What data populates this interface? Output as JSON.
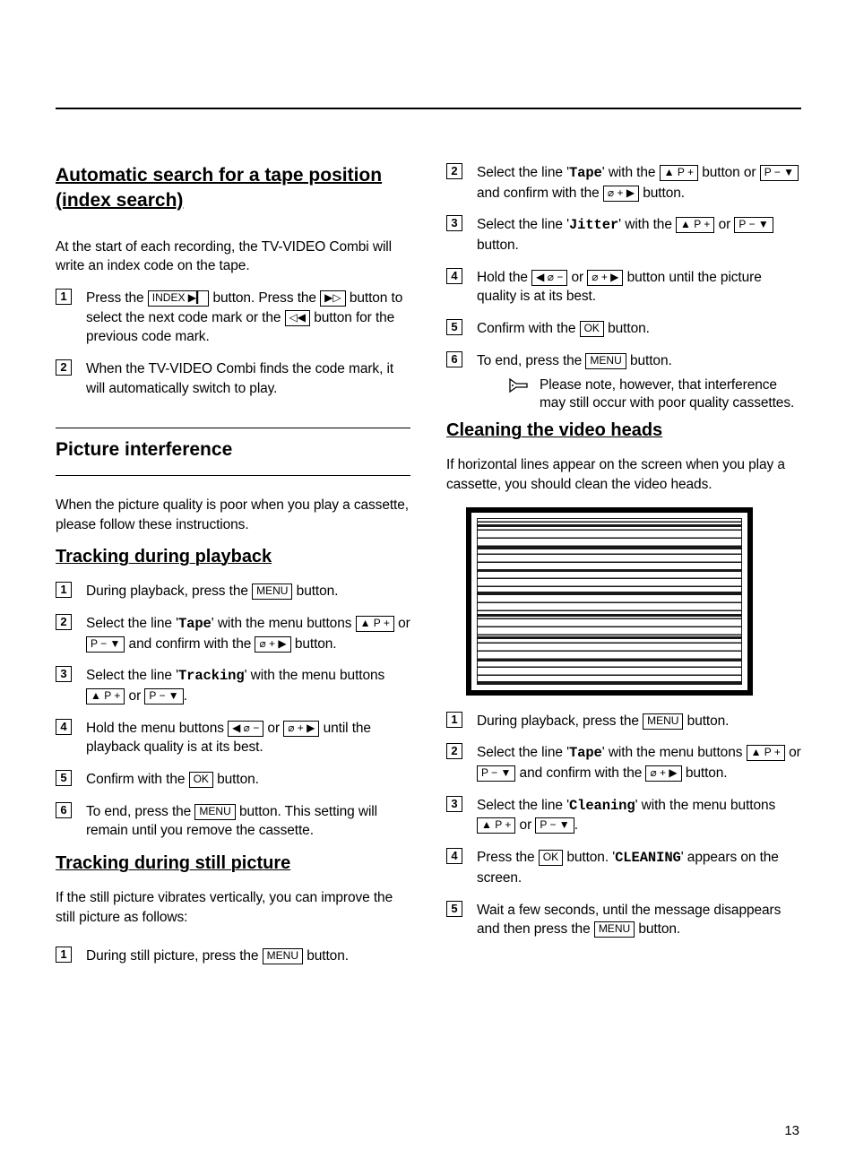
{
  "pagenum": "13",
  "keys": {
    "index": "INDEX ▶▎",
    "ff": "▶▷",
    "rew": "◁◀",
    "menu": "MENU",
    "pplus": "▲ P +",
    "pminus": "P − ▼",
    "aplus": "⌀ + ▶",
    "aminus": "◀ ⌀ −",
    "ok": "OK"
  },
  "left": {
    "s1_title": "Automatic search for a tape position (index search)",
    "s1_intro": "At the start of each recording, the TV-VIDEO Combi will write an index code on the tape.",
    "s1_step1a": "Press the ",
    "s1_step1b": " button. Press the ",
    "s1_step1c": " button to select the next code mark or the ",
    "s1_step1d": " button for the previous code mark.",
    "s1_step2": "When the TV-VIDEO Combi finds the code mark, it will automatically switch to play.",
    "s2_title": "Picture interference",
    "s2_intro": "When the picture quality is poor when you play a cassette, please follow these instructions.",
    "s2a_title": "Tracking during playback",
    "s2a_1a": "During playback, press the ",
    "s2a_1b": " button.",
    "s2a_2a": "Select the line '",
    "s2a_2tape": "Tape",
    "s2a_2b": "' with the menu buttons ",
    "s2a_2c": " or ",
    "s2a_2d": " and confirm with the ",
    "s2a_2e": " button.",
    "s2a_3a": "Select the line '",
    "s2a_3track": "Tracking",
    "s2a_3b": "' with the menu buttons ",
    "s2a_3c": " or ",
    "s2a_3d": ".",
    "s2a_4a": "Hold the menu buttons ",
    "s2a_4b": " or ",
    "s2a_4c": " until the playback quality is at its best.",
    "s2a_5a": "Confirm with the ",
    "s2a_5b": " button.",
    "s2a_6a": "To end, press the ",
    "s2a_6b": " button. This setting will remain until you remove the cassette.",
    "s2b_title": "Tracking during still picture",
    "s2b_intro": "If the still picture vibrates vertically, you can improve the still picture as follows:",
    "s2b_1a": "During still picture, press the ",
    "s2b_1b": " button.",
    "s2b_2a": "Select the line '",
    "s2b_2tape": "Tape",
    "s2b_2b": "' with the ",
    "s2b_2c": " button or ",
    "s2b_2d": " and confirm with the ",
    "s2b_2e": " button.",
    "s2b_3a": "Select the line '",
    "s2b_3jit": "Jitter",
    "s2b_3b": "' with the ",
    "s2b_3c": " or ",
    "s2b_3d": " button."
  },
  "right": {
    "r_4a": "Hold the ",
    "r_4b": " or ",
    "r_4c": " button until the picture quality is at its best.",
    "r_5a": "Confirm with the ",
    "r_5b": " button.",
    "r_6a": "To end, press the ",
    "r_6b": " button.",
    "r_note": "Please note, however, that interference may still occur with poor quality cassettes.",
    "c_title": "Cleaning the video heads",
    "c_intro": "If horizontal lines appear on the screen when you play a cassette, you should clean the video heads.",
    "c_1a": "During playback, press the ",
    "c_1b": " button.",
    "c_2a": "Select the line '",
    "c_2tape": "Tape",
    "c_2b": "' with the menu buttons ",
    "c_2c": " or ",
    "c_2d": " and confirm with the ",
    "c_2e": " button.",
    "c_3a": "Select the line '",
    "c_3clean": "Cleaning",
    "c_3b": "' with the menu buttons ",
    "c_3c": " or ",
    "c_3d": ".",
    "c_4a": "Press the ",
    "c_4b": " button. '",
    "c_4clean": "CLEANING",
    "c_4c": "' appears on the screen.",
    "c_5a": "Wait a few seconds, until the message disappears and then press the ",
    "c_5b": " button."
  }
}
